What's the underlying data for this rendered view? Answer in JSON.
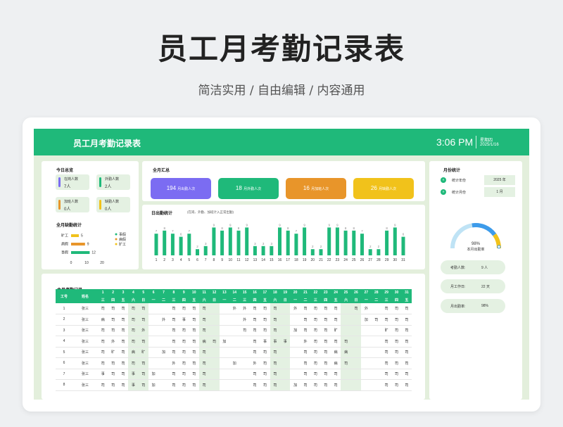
{
  "hero": {
    "title": "员工月考勤记录表",
    "subtitle": "简洁实用 / 自由编辑 / 内容通用"
  },
  "app": {
    "title": "员工月考勤记录表",
    "time": "3:06 PM",
    "weekday": "星期四",
    "date": "2025/1/16"
  },
  "today": {
    "title": "今日总览",
    "items": [
      {
        "label": "在岗人数",
        "value": "7人",
        "color": "#7b6cf2"
      },
      {
        "label": "外勤人数",
        "value": "2人",
        "color": "#1fb97a"
      },
      {
        "label": "加班人数",
        "value": "0人",
        "color": "#e8952a"
      },
      {
        "label": "缺勤人数",
        "value": "0人",
        "color": "#f1c21b"
      }
    ]
  },
  "absence": {
    "title": "全月缺勤统计",
    "categories": [
      "旷工",
      "病假",
      "事假"
    ],
    "values": [
      5,
      9,
      12
    ],
    "colors": [
      "#f1c21b",
      "#e8952a",
      "#1fb97a"
    ],
    "ticks": [
      "0",
      "10",
      "20"
    ],
    "legend": [
      "事假",
      "病假",
      "旷工"
    ]
  },
  "summary": {
    "title": "全月汇总",
    "stats": [
      {
        "value": "194",
        "label": "月出勤人次",
        "color": "#7b6cf2"
      },
      {
        "value": "18",
        "label": "月外勤人次",
        "color": "#1fb97a"
      },
      {
        "value": "16",
        "label": "月加班人次",
        "color": "#e8952a"
      },
      {
        "value": "26",
        "label": "月缺勤人次",
        "color": "#f1c21b"
      }
    ]
  },
  "chart_data": {
    "type": "bar",
    "title": "日出勤统计",
    "subtitle": "(在岗、外勤、加班计入正常出勤)",
    "categories": [
      "1",
      "2",
      "3",
      "4",
      "5",
      "6",
      "7",
      "8",
      "9",
      "10",
      "11",
      "12",
      "13",
      "14",
      "15",
      "16",
      "17",
      "18",
      "19",
      "20",
      "21",
      "22",
      "23",
      "24",
      "25",
      "26",
      "27",
      "28",
      "29",
      "30",
      "31"
    ],
    "values": [
      7,
      8,
      7,
      6,
      7,
      2,
      3,
      9,
      8,
      9,
      8,
      9,
      3,
      3,
      3,
      9,
      8,
      7,
      9,
      2,
      2,
      9,
      9,
      8,
      8,
      7,
      2,
      2,
      8,
      9,
      6
    ],
    "ylim": [
      0,
      10
    ],
    "color": "#1fb97a"
  },
  "table": {
    "title": "本月考勤记录",
    "col_id": "工号",
    "col_name": "姓名",
    "days": [
      "1",
      "2",
      "3",
      "4",
      "5",
      "6",
      "7",
      "8",
      "9",
      "10",
      "11",
      "12",
      "13",
      "14",
      "15",
      "16",
      "17",
      "18",
      "19",
      "20",
      "21",
      "22",
      "23",
      "24",
      "25",
      "26",
      "27",
      "28",
      "29",
      "30",
      "31"
    ],
    "weekdays": [
      "三",
      "四",
      "五",
      "六",
      "日",
      "一",
      "二",
      "三",
      "四",
      "五",
      "六",
      "日",
      "一",
      "二",
      "三",
      "四",
      "五",
      "六",
      "日",
      "一",
      "二",
      "三",
      "四",
      "五",
      "六",
      "日",
      "一",
      "二",
      "三",
      "四",
      "五"
    ],
    "rows": [
      {
        "id": "1",
        "name": "张三",
        "cells": [
          "司",
          "司",
          "司",
          "司",
          "司",
          "",
          "",
          "司",
          "司",
          "司",
          "司",
          "",
          "",
          "外",
          "外",
          "司",
          "司",
          "司",
          "",
          "外",
          "司",
          "司",
          "司",
          "司",
          "",
          "司",
          "外",
          "",
          "司",
          "司",
          "司"
        ]
      },
      {
        "id": "2",
        "name": "张三",
        "cells": [
          "病",
          "司",
          "司",
          "司",
          "司",
          "",
          "外",
          "司",
          "事",
          "司",
          "司",
          "",
          "",
          "",
          "外",
          "司",
          "司",
          "司",
          "",
          "",
          "司",
          "司",
          "司",
          "司",
          "",
          "",
          "加",
          "司",
          "司",
          "司",
          "司"
        ]
      },
      {
        "id": "3",
        "name": "张三",
        "cells": [
          "司",
          "司",
          "司",
          "司",
          "外",
          "",
          "",
          "司",
          "司",
          "司",
          "司",
          "",
          "",
          "",
          "司",
          "司",
          "司",
          "司",
          "",
          "加",
          "司",
          "司",
          "司",
          "旷",
          "",
          "",
          "",
          "",
          "旷",
          "司",
          "司"
        ]
      },
      {
        "id": "4",
        "name": "张三",
        "cells": [
          "司",
          "外",
          "司",
          "司",
          "司",
          "",
          "",
          "司",
          "司",
          "司",
          "病",
          "司",
          "加",
          "",
          "",
          "司",
          "事",
          "事",
          "事",
          "",
          "外",
          "司",
          "司",
          "司",
          "司",
          "",
          "",
          "",
          "司",
          "司",
          "司"
        ]
      },
      {
        "id": "5",
        "name": "张三",
        "cells": [
          "司",
          "旷",
          "司",
          "病",
          "旷",
          "",
          "加",
          "司",
          "司",
          "司",
          "司",
          "",
          "",
          "",
          "",
          "司",
          "司",
          "司",
          "",
          "",
          "司",
          "司",
          "司",
          "病",
          "病",
          "",
          "",
          "",
          "司",
          "司",
          "司"
        ]
      },
      {
        "id": "6",
        "name": "张三",
        "cells": [
          "司",
          "司",
          "司",
          "司",
          "司",
          "",
          "",
          "外",
          "司",
          "司",
          "司",
          "",
          "",
          "加",
          "",
          "外",
          "司",
          "司",
          "",
          "",
          "司",
          "司",
          "司",
          "病",
          "司",
          "",
          "",
          "",
          "司",
          "司",
          "司"
        ]
      },
      {
        "id": "7",
        "name": "张三",
        "cells": [
          "事",
          "司",
          "司",
          "事",
          "司",
          "加",
          "",
          "司",
          "司",
          "司",
          "司",
          "",
          "",
          "",
          "",
          "司",
          "司",
          "司",
          "",
          "",
          "司",
          "司",
          "司",
          "司",
          "",
          "",
          "",
          "",
          "司",
          "司",
          "司"
        ]
      },
      {
        "id": "8",
        "name": "张三",
        "cells": [
          "司",
          "司",
          "司",
          "事",
          "司",
          "加",
          "",
          "司",
          "司",
          "司",
          "司",
          "",
          "",
          "",
          "",
          "司",
          "司",
          "司",
          "",
          "加",
          "司",
          "司",
          "司",
          "司",
          "",
          "",
          "",
          "",
          "司",
          "司",
          "司"
        ]
      }
    ]
  },
  "month": {
    "title": "月份统计",
    "year_label": "统计年份",
    "year_value": "2025 年",
    "month_label": "统计月份",
    "month_value": "1 月",
    "gauge_value": "98%",
    "gauge_label": "本月出勤率",
    "gauge_fraction": 0.98,
    "metrics": [
      {
        "label": "考勤人数:",
        "value": "9 人"
      },
      {
        "label": "月工作日:",
        "value": "22 天"
      },
      {
        "label": "月出勤率:",
        "value": "98%"
      }
    ]
  }
}
